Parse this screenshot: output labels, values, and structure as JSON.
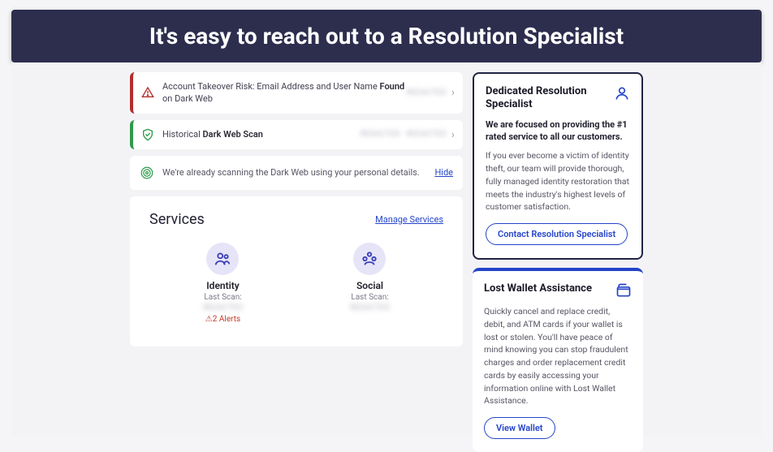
{
  "banner": "It's easy to reach out to a Resolution Specialist",
  "alerts": [
    {
      "text_prefix": "Account Takeover Risk: Email Address and User Name ",
      "text_bold": "Found",
      "text_suffix": " on Dark Web",
      "meta": "REDACTED"
    },
    {
      "text_prefix": "Historical ",
      "text_bold": "Dark Web Scan",
      "text_suffix": "",
      "meta": "REDACTED · REDACTED"
    }
  ],
  "info": {
    "message": "We're already scanning the Dark Web using your personal details.",
    "hide": "Hide"
  },
  "services": {
    "title": "Services",
    "manage": "Manage Services",
    "items": [
      {
        "name": "Identity",
        "sub": "Last Scan:",
        "blur": "REDACTED",
        "alerts": "⚠2 Alerts"
      },
      {
        "name": "Social",
        "sub": "Last Scan:",
        "blur": "REDACTED",
        "alerts": ""
      }
    ]
  },
  "cards": {
    "resolution": {
      "title": "Dedicated Resolution Specialist",
      "subtitle": "We are focused on providing the #1 rated service to all our customers.",
      "body": "If you ever become a victim of identity theft, our team will provide thorough, fully managed identity restoration that meets the industry's highest levels of customer satisfaction.",
      "cta": "Contact Resolution Specialist"
    },
    "wallet": {
      "title": "Lost Wallet Assistance",
      "body": "Quickly cancel and replace credit, debit, and ATM cards if your wallet is lost or stolen. You'll have peace of mind knowing you can stop fraudulent charges and order replacement credit cards by easily accessing your information online with Lost Wallet Assistance.",
      "cta": "View Wallet"
    }
  }
}
